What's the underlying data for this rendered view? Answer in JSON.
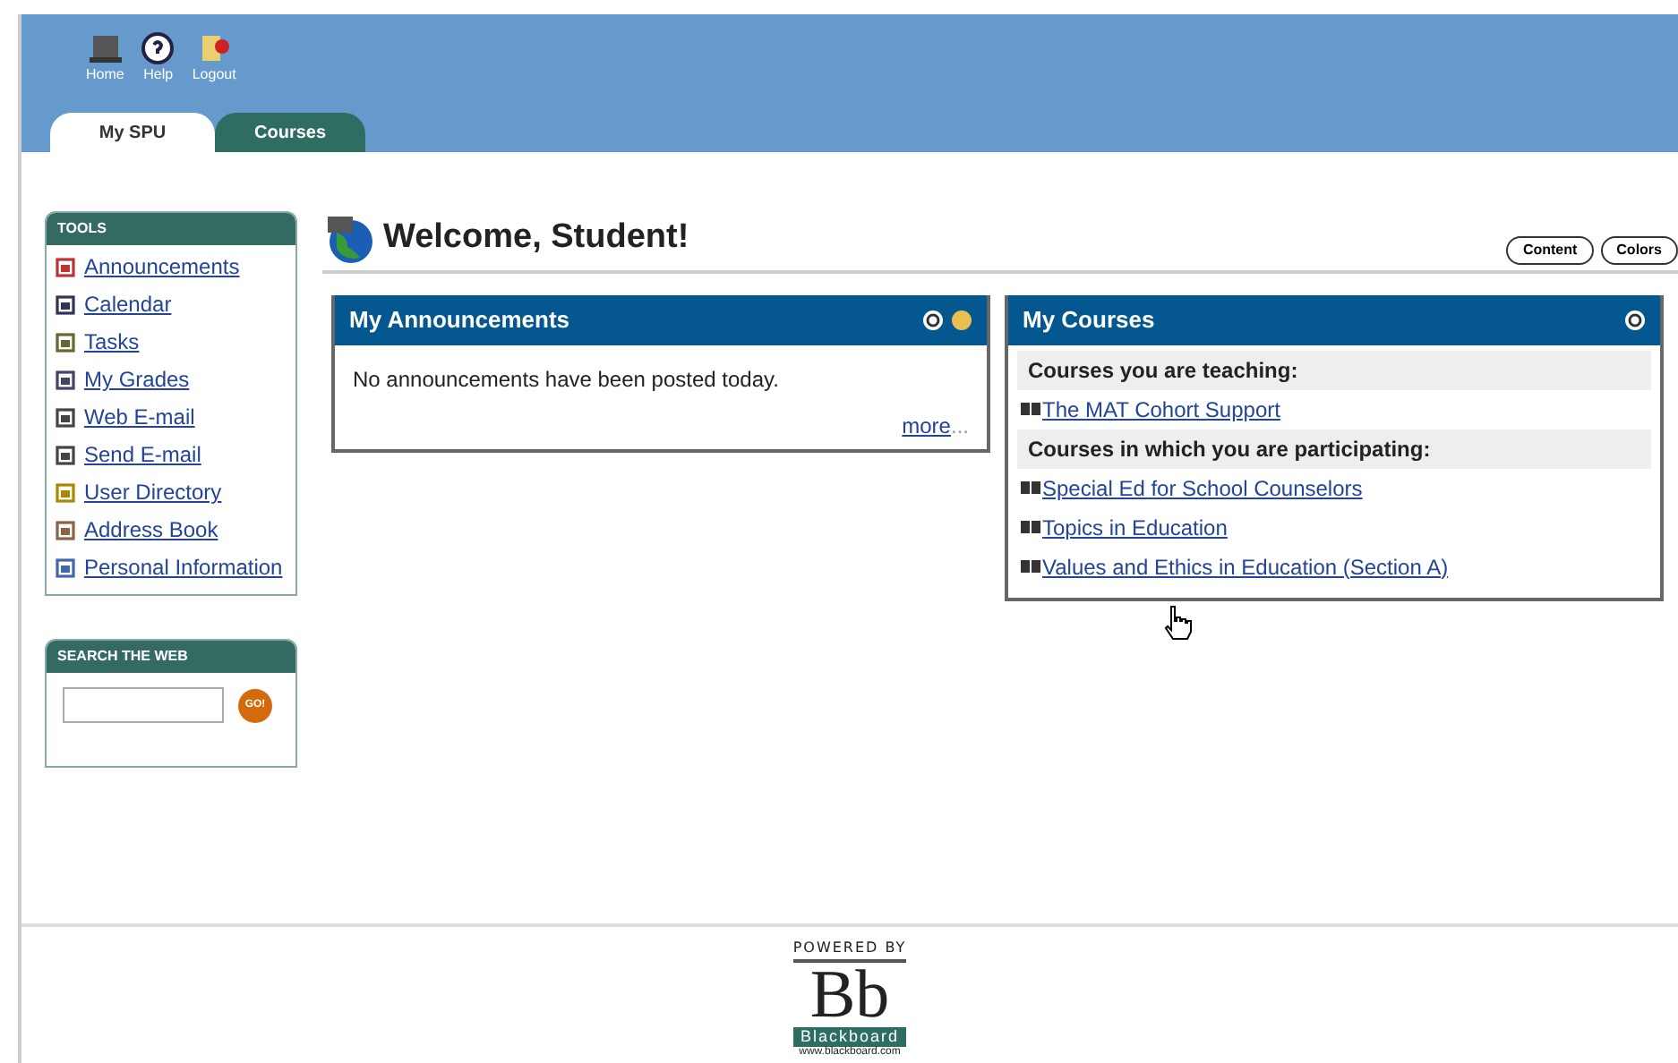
{
  "header": {
    "links": [
      {
        "label": "Home"
      },
      {
        "label": "Help"
      },
      {
        "label": "Logout"
      }
    ]
  },
  "tabs": [
    {
      "label": "My SPU",
      "selected": true
    },
    {
      "label": "Courses",
      "selected": false
    }
  ],
  "tools": {
    "title": "TOOLS",
    "items": [
      {
        "label": "Announcements"
      },
      {
        "label": "Calendar"
      },
      {
        "label": "Tasks"
      },
      {
        "label": "My Grades"
      },
      {
        "label": "Web E-mail"
      },
      {
        "label": "Send E-mail"
      },
      {
        "label": "User Directory"
      },
      {
        "label": "Address Book"
      },
      {
        "label": "Personal Information"
      }
    ]
  },
  "search": {
    "title": "SEARCH THE WEB",
    "button": "GO!"
  },
  "welcome": {
    "title": "Welcome, Student!",
    "buttons": [
      "Content",
      "Colors"
    ]
  },
  "announcements": {
    "title": "My Announcements",
    "message": "No announcements have been posted today.",
    "more": "more",
    "more_suffix": "..."
  },
  "courses": {
    "title": "My Courses",
    "groups": [
      {
        "heading": "Courses you are teaching:",
        "items": [
          "The MAT Cohort Support"
        ]
      },
      {
        "heading": "Courses in which you are participating:",
        "items": [
          "Special Ed for School Counselors",
          "Topics in Education",
          "Values and Ethics in Education (Section A)"
        ]
      }
    ]
  },
  "footer": {
    "powered": "POWERED BY",
    "mark": "Bb",
    "name": "Blackboard",
    "url": "www.blackboard.com"
  }
}
